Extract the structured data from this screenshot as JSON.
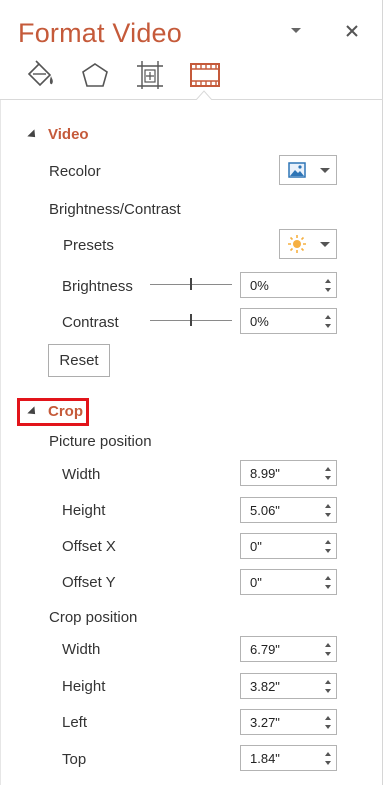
{
  "header": {
    "title": "Format Video"
  },
  "tabs": [
    {
      "name": "fill-line",
      "icon": "paint-bucket-icon"
    },
    {
      "name": "effects",
      "icon": "pentagon-icon"
    },
    {
      "name": "size-properties",
      "icon": "size-position-icon"
    },
    {
      "name": "video",
      "icon": "film-strip-icon",
      "selected": true
    }
  ],
  "video": {
    "section_label": "Video",
    "recolor_label": "Recolor",
    "brightness_contrast_label": "Brightness/Contrast",
    "presets_label": "Presets",
    "brightness_label": "Brightness",
    "brightness_value": "0%",
    "contrast_label": "Contrast",
    "contrast_value": "0%",
    "reset_label": "Reset"
  },
  "crop": {
    "section_label": "Crop",
    "picture_position_label": "Picture position",
    "picture_position": {
      "width_label": "Width",
      "width_value": "8.99\"",
      "height_label": "Height",
      "height_value": "5.06\"",
      "offset_x_label": "Offset X",
      "offset_x_value": "0\"",
      "offset_y_label": "Offset Y",
      "offset_y_value": "0\""
    },
    "crop_position_label": "Crop position",
    "crop_position": {
      "width_label": "Width",
      "width_value": "6.79\"",
      "height_label": "Height",
      "height_value": "3.82\"",
      "left_label": "Left",
      "left_value": "3.27\"",
      "top_label": "Top",
      "top_value": "1.84\""
    }
  },
  "colors": {
    "accent": "#c55a3a",
    "highlight": "#e2141a"
  }
}
